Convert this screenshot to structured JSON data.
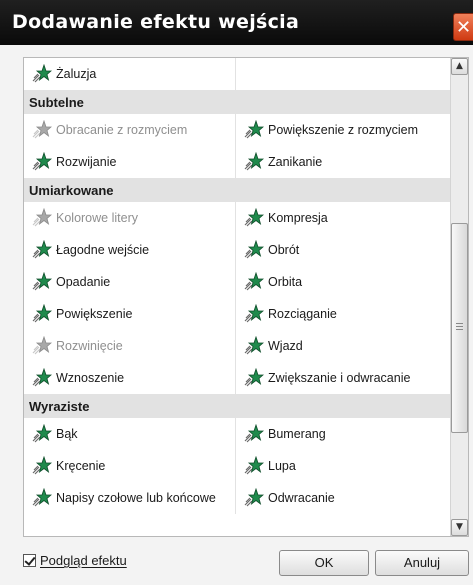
{
  "window": {
    "title": "Dodawanie efektu wejścia",
    "close_label": "✕"
  },
  "list": {
    "sections": [
      {
        "header": null,
        "rows": [
          [
            {
              "label": "Żaluzja",
              "enabled": true,
              "icon": "blinds-effect-icon"
            },
            null
          ]
        ]
      },
      {
        "header": "Subtelne",
        "rows": [
          [
            {
              "label": "Obracanie z rozmyciem",
              "enabled": false,
              "icon": "spin-blur-effect-icon"
            },
            {
              "label": "Powiększenie z rozmyciem",
              "enabled": true,
              "icon": "zoom-blur-effect-icon"
            }
          ],
          [
            {
              "label": "Rozwijanie",
              "enabled": true,
              "icon": "expand-effect-icon"
            },
            {
              "label": "Zanikanie",
              "enabled": true,
              "icon": "fade-effect-icon"
            }
          ]
        ]
      },
      {
        "header": "Umiarkowane",
        "rows": [
          [
            {
              "label": "Kolorowe litery",
              "enabled": false,
              "icon": "color-letters-effect-icon"
            },
            {
              "label": "Kompresja",
              "enabled": true,
              "icon": "compress-effect-icon"
            }
          ],
          [
            {
              "label": "Łagodne wejście",
              "enabled": true,
              "icon": "ease-in-effect-icon"
            },
            {
              "label": "Obrót",
              "enabled": true,
              "icon": "rotate-effect-icon"
            }
          ],
          [
            {
              "label": "Opadanie",
              "enabled": true,
              "icon": "drop-effect-icon"
            },
            {
              "label": "Orbita",
              "enabled": true,
              "icon": "orbit-effect-icon"
            }
          ],
          [
            {
              "label": "Powiększenie",
              "enabled": true,
              "icon": "zoom-effect-icon"
            },
            {
              "label": "Rozciąganie",
              "enabled": true,
              "icon": "stretch-effect-icon"
            }
          ],
          [
            {
              "label": "Rozwinięcie",
              "enabled": false,
              "icon": "unfold-effect-icon"
            },
            {
              "label": "Wjazd",
              "enabled": true,
              "icon": "slide-in-effect-icon"
            }
          ],
          [
            {
              "label": "Wznoszenie",
              "enabled": true,
              "icon": "rise-up-effect-icon"
            },
            {
              "label": "Zwiększanie i odwracanie",
              "enabled": true,
              "icon": "grow-turn-effect-icon"
            }
          ]
        ]
      },
      {
        "header": "Wyraziste",
        "rows": [
          [
            {
              "label": "Bąk",
              "enabled": true,
              "icon": "spinner-effect-icon"
            },
            {
              "label": "Bumerang",
              "enabled": true,
              "icon": "boomerang-effect-icon"
            }
          ],
          [
            {
              "label": "Kręcenie",
              "enabled": true,
              "icon": "pinwheel-effect-icon"
            },
            {
              "label": "Lupa",
              "enabled": true,
              "icon": "magnify-effect-icon"
            }
          ],
          [
            {
              "label": "Napisy czołowe lub końcowe",
              "enabled": true,
              "icon": "credits-effect-icon"
            },
            {
              "label": "Odwracanie",
              "enabled": true,
              "icon": "flip-effect-icon"
            }
          ]
        ]
      }
    ]
  },
  "scrollbar": {
    "up_glyph": "▲",
    "down_glyph": "▼",
    "scroll_position": 0.55
  },
  "footer": {
    "preview_label": "Podgląd efektu",
    "preview_checked": true,
    "ok_label": "OK",
    "cancel_label": "Anuluj"
  },
  "colors": {
    "titlebar": "#111111",
    "close_button": "#e05a2a",
    "star_enabled": "#1f8a4c",
    "star_disabled": "#a8a8a8",
    "section_header_bg": "#e2e2e2"
  }
}
